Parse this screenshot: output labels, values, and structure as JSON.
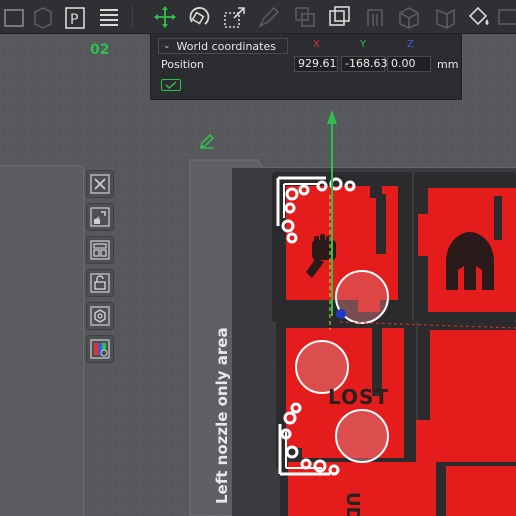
{
  "toolbar": {
    "icons": [
      "box-icon",
      "cube-icon",
      "plate-p-icon",
      "list-icon",
      "move-icon",
      "rotate-icon",
      "scale-icon",
      "pencil-icon",
      "layers-icon",
      "cut-icon",
      "support-icon",
      "cube-outline-icon",
      "seam-icon",
      "paint-icon"
    ]
  },
  "plate": {
    "number": "02"
  },
  "coordinates": {
    "mode": "World coordinates",
    "axes": {
      "x": "X",
      "y": "Y",
      "z": "Z"
    },
    "position_label": "Position",
    "x_value": "929.61",
    "y_value": "-168.63",
    "z_value": "0.00",
    "unit": "mm"
  },
  "side_tools": [
    "close-icon",
    "auto-orient-icon",
    "arrange-icon",
    "lock-icon",
    "settings-icon",
    "plate-color-icon"
  ],
  "scene": {
    "zone_label": "Left nozzle only area",
    "part_text": "LOST"
  },
  "colors": {
    "accent": "#2ec04c",
    "part_red": "#e41c1c",
    "axis_x": "#e5312b",
    "axis_y": "#2ec04c",
    "axis_z": "#3a5bdc"
  }
}
